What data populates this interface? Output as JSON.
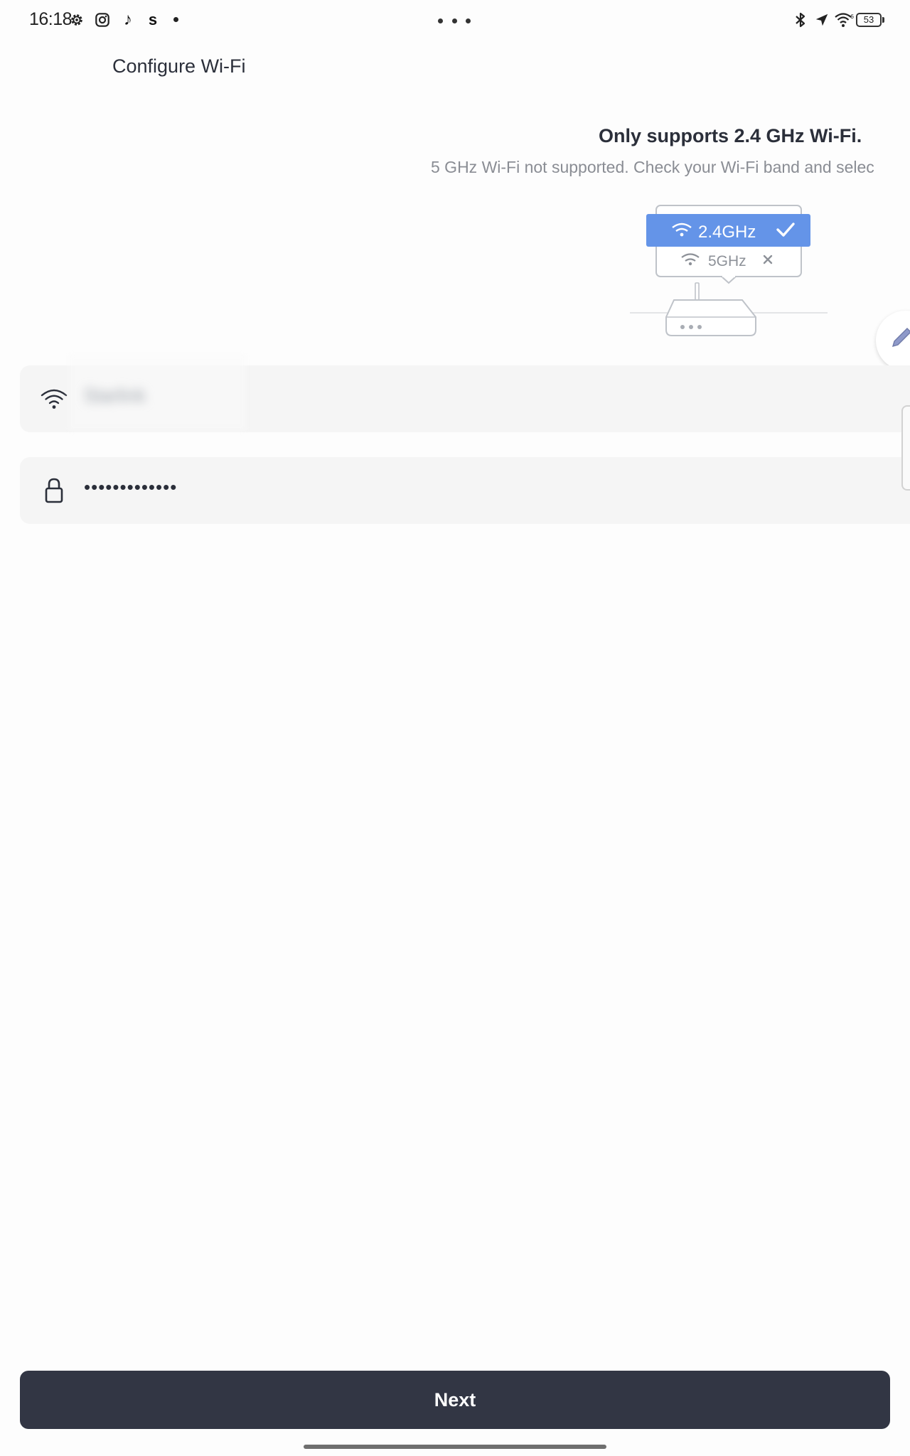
{
  "status_bar": {
    "time": "16:18",
    "tiktok_glyph": "♪",
    "s_glyph": "s",
    "battery_level": "53",
    "icons": [
      "settings-icon",
      "instagram-icon",
      "tiktok-icon",
      "shazam-icon",
      "bluetooth-icon",
      "location-icon",
      "wifi-6-icon",
      "battery-icon"
    ]
  },
  "header": {
    "title": "Configure Wi-Fi"
  },
  "notice": {
    "title": "Only supports 2.4 GHz Wi-Fi.",
    "description": "5 GHz Wi-Fi not supported. Check your Wi-Fi band and selec"
  },
  "illustration": {
    "band_supported": "2.4GHz",
    "band_unsupported": "5GHz",
    "accent_color": "#6494e8"
  },
  "form": {
    "ssid_value": "Starlink",
    "password_value": "•••••••••••••"
  },
  "actions": {
    "next_label": "Next"
  },
  "colors": {
    "button_bg": "#323644",
    "field_bg": "#f5f5f5",
    "text_primary": "#2b2f3a",
    "text_secondary": "#8a8d94"
  }
}
